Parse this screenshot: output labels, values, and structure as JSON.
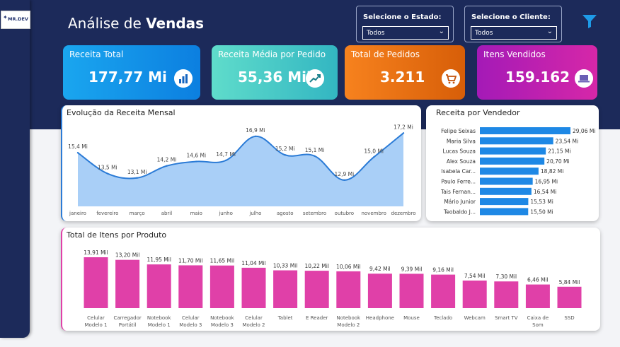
{
  "header": {
    "title_prefix": "Análise de",
    "title_bold": "Vendas",
    "logo_text": "MR.DEV",
    "state_filter": {
      "label": "Selecione o Estado:",
      "value": "Todos"
    },
    "client_filter": {
      "label": "Selecione o Cliente:",
      "value": "Todos"
    }
  },
  "colors": {
    "navy": "#1c2a5a",
    "line": "#2b7bd6",
    "area": "#a9cff7",
    "bar_seller": "#1e88e5",
    "bar_product": "#e040a8"
  },
  "kpis": [
    {
      "label": "Receita Total",
      "value": "177,77 Mi",
      "icon": "bar-chart-icon"
    },
    {
      "label": "Receita Média por Pedido",
      "value": "55,36 Mil",
      "icon": "trend-up-icon"
    },
    {
      "label": "Total de Pedidos",
      "value": "3.211",
      "icon": "shopping-cart-icon"
    },
    {
      "label": "Itens Vendidos",
      "value": "159.162",
      "icon": "laptop-icon"
    }
  ],
  "line_panel": {
    "title": "Evolução da Receita Mensal"
  },
  "seller_panel": {
    "title": "Receita por Vendedor"
  },
  "product_panel": {
    "title": "Total de Itens por Produto"
  },
  "chart_data": [
    {
      "type": "area",
      "title": "Evolução da Receita Mensal",
      "categories": [
        "janeiro",
        "fevereiro",
        "março",
        "abril",
        "maio",
        "junho",
        "julho",
        "agosto",
        "setembro",
        "outubro",
        "novembro",
        "dezembro"
      ],
      "values": [
        15.4,
        13.5,
        13.1,
        14.2,
        14.6,
        14.7,
        16.9,
        15.2,
        15.1,
        12.9,
        15.0,
        17.2
      ],
      "labels": [
        "15,4 Mi",
        "13,5 Mi",
        "13,1 Mi",
        "14,2 Mi",
        "14,6 Mi",
        "14,7 Mi",
        "16,9 Mi",
        "15,2 Mi",
        "15,1 Mi",
        "12,9 Mi",
        "15,0 Mi",
        "17,2 Mi"
      ],
      "unit": "Mi",
      "ylim": [
        10.5,
        17.8
      ],
      "grid": false
    },
    {
      "type": "bar",
      "orientation": "horizontal",
      "title": "Receita por Vendedor",
      "categories": [
        "Felipe Seixas",
        "Maria Silva",
        "Lucas Souza",
        "Alex Souza",
        "Isabela Car...",
        "Paulo Ferre...",
        "Tais Fernan...",
        "Mário Junior",
        "Teobaldo J..."
      ],
      "values": [
        29.06,
        23.54,
        21.15,
        20.7,
        18.82,
        16.95,
        16.54,
        15.53,
        15.5
      ],
      "labels": [
        "29,06 Mi",
        "23,54 Mi",
        "21,15 Mi",
        "20,70 Mi",
        "18,82 Mi",
        "16,95 Mi",
        "16,54 Mi",
        "15,53 Mi",
        "15,50 Mi"
      ],
      "unit": "Mi",
      "xlim": [
        0,
        29.06
      ]
    },
    {
      "type": "bar",
      "title": "Total de Itens por Produto",
      "categories": [
        [
          "Celular",
          "Modelo 1"
        ],
        [
          "Carregador",
          "Portátil"
        ],
        [
          "Notebook",
          "Modelo 1"
        ],
        [
          "Celular",
          "Modelo 3"
        ],
        [
          "Notebook",
          "Modelo 3"
        ],
        [
          "Celular",
          "Modelo 2"
        ],
        [
          "Tablet"
        ],
        [
          "E Reader"
        ],
        [
          "Notebook",
          "Modelo 2"
        ],
        [
          "Headphone"
        ],
        [
          "Mouse"
        ],
        [
          "Teclado"
        ],
        [
          "Webcam"
        ],
        [
          "Smart TV"
        ],
        [
          "Caixa de",
          "Som"
        ],
        [
          "SSD"
        ]
      ],
      "values": [
        13.91,
        13.2,
        11.95,
        11.7,
        11.65,
        11.04,
        10.33,
        10.22,
        10.06,
        9.42,
        9.39,
        9.16,
        7.54,
        7.3,
        6.46,
        5.84
      ],
      "labels": [
        "13,91 Mil",
        "13,20 Mil",
        "11,95 Mil",
        "11,70 Mil",
        "11,65 Mil",
        "11,04 Mil",
        "10,33 Mil",
        "10,22 Mil",
        "10,06 Mil",
        "9,42 Mil",
        "9,39 Mil",
        "9,16 Mil",
        "7,54 Mil",
        "7,30 Mil",
        "6,46 Mil",
        "5,84 Mil"
      ],
      "unit": "Mil",
      "ylim": [
        0,
        13.91
      ]
    }
  ]
}
